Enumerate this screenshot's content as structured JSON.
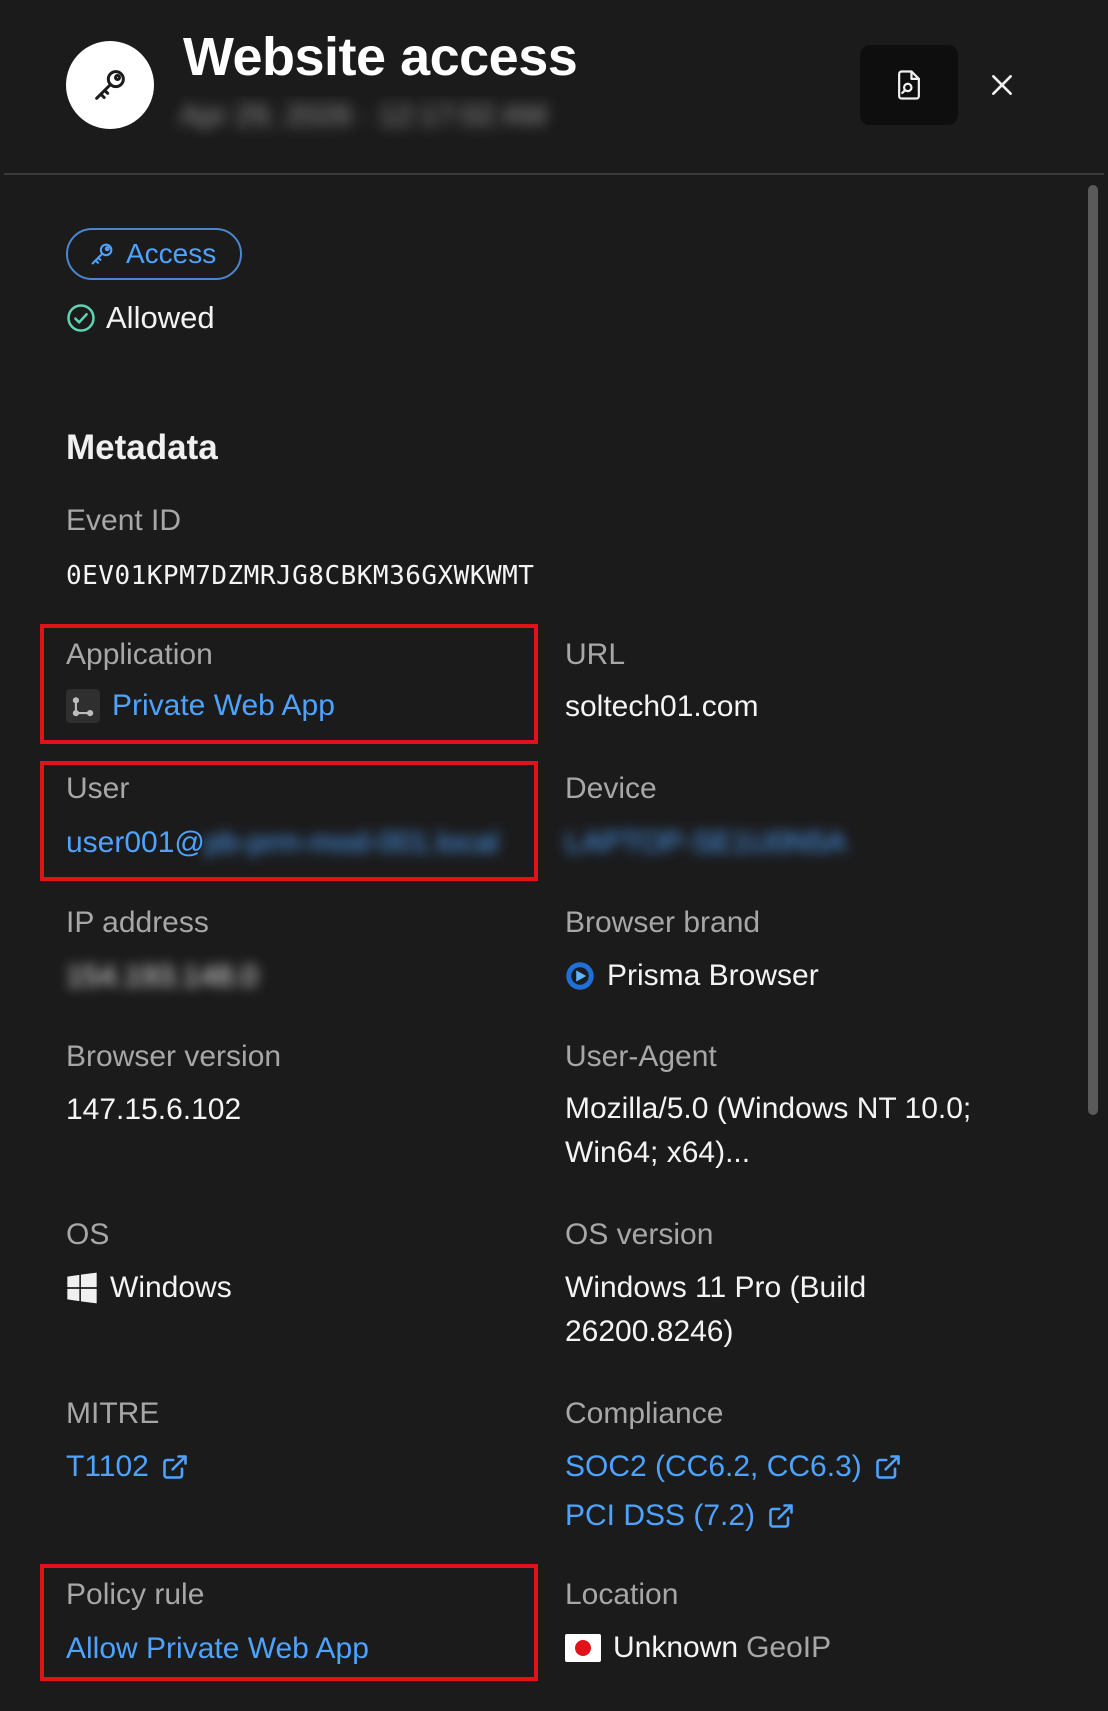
{
  "header": {
    "title": "Website access",
    "subtitle": "Apr 29, 2026 · 12:17:02 AM",
    "report_icon": "report-search-icon",
    "close_icon": "close-icon"
  },
  "event": {
    "category": "Access",
    "category_icon": "key-icon",
    "status": "Allowed",
    "status_icon": "check-circle-icon"
  },
  "metadata": {
    "title": "Metadata",
    "event_id": {
      "label": "Event ID",
      "value": "0EV01KPM7DZMRJG8CBKM36GXWKWMT"
    },
    "application": {
      "label": "Application",
      "value": "Private Web App"
    },
    "url": {
      "label": "URL",
      "value": "soltech01.com"
    },
    "user": {
      "label": "User",
      "value_prefix": "user001@",
      "value_hidden": "pb-prm-mod-001.local"
    },
    "device": {
      "label": "Device",
      "value": "LAPTOP-SE1U0N5A"
    },
    "ip_address": {
      "label": "IP address",
      "value": "154.193.148.0"
    },
    "browser_brand": {
      "label": "Browser brand",
      "value": "Prisma Browser"
    },
    "browser_version": {
      "label": "Browser version",
      "value": "147.15.6.102"
    },
    "user_agent": {
      "label": "User-Agent",
      "value": "Mozilla/5.0 (Windows NT 10.0; Win64; x64)..."
    },
    "os": {
      "label": "OS",
      "value": "Windows"
    },
    "os_version": {
      "label": "OS version",
      "value": "Windows 11 Pro (Build 26200.8246)"
    },
    "mitre": {
      "label": "MITRE",
      "value": "T1102"
    },
    "compliance": {
      "label": "Compliance",
      "items": [
        "SOC2 (CC6.2, CC6.3)",
        "PCI DSS (7.2)"
      ]
    },
    "policy_rule": {
      "label": "Policy rule",
      "value": "Allow Private Web App"
    },
    "location": {
      "label": "Location",
      "value": "Unknown",
      "suffix": "GeoIP"
    }
  },
  "colors": {
    "background": "#1b1b1c",
    "link": "#4da3ff",
    "status_ok": "#5fd3b3",
    "highlight": "#e0131b"
  }
}
